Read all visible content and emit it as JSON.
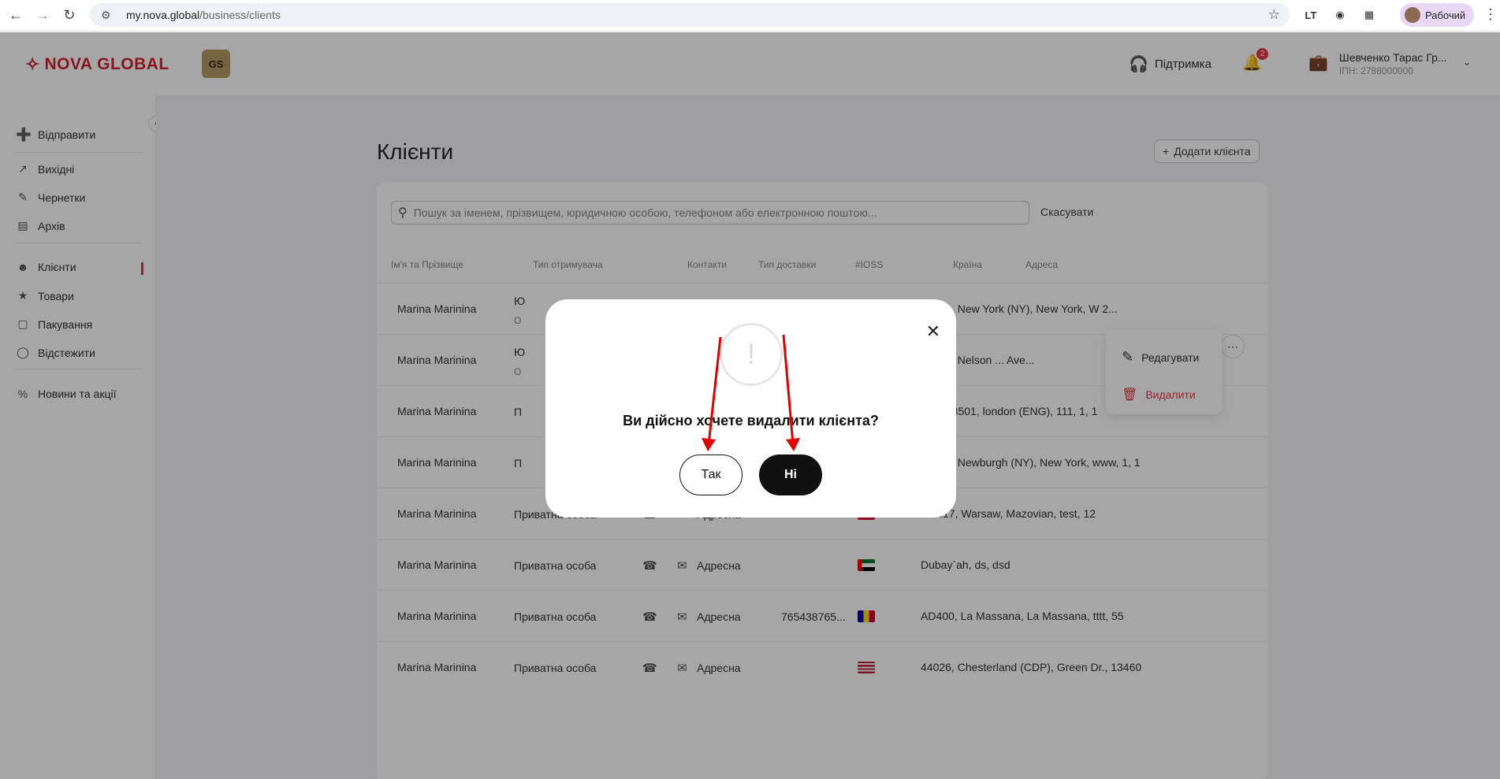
{
  "browser": {
    "url_host": "my.nova.global",
    "url_path": "/business/clients",
    "profile_label": "Рабочий"
  },
  "header": {
    "logo_text": "NOVA GLOBAL",
    "badge_text": "GS",
    "support_label": "Підтримка",
    "notifications_count": "2",
    "account_name": "Шевченко Тарас Гр...",
    "account_inn": "ІПН: 2788000000"
  },
  "sidebar": {
    "send_label": "Відправити",
    "items": [
      {
        "label": "Вихідні",
        "icon": "arrow-outgoing-icon"
      },
      {
        "label": "Чернетки",
        "icon": "edit-icon"
      },
      {
        "label": "Архів",
        "icon": "archive-icon"
      },
      {
        "label": "Клієнти",
        "icon": "user-icon"
      },
      {
        "label": "Товари",
        "icon": "tag-icon"
      },
      {
        "label": "Пакування",
        "icon": "box-icon"
      },
      {
        "label": "Відстежити",
        "icon": "track-icon"
      },
      {
        "label": "Новини та акції",
        "icon": "percent-icon"
      }
    ],
    "active_item": "Клієнти"
  },
  "main": {
    "title": "Клієнти",
    "add_button": "Додати клієнта",
    "search_placeholder": "Пошук за іменем, прізвищем, юридичною особою, телефоном або електронною поштою...",
    "cancel_label": "Скасувати",
    "columns": [
      "Ім'я та Прізвище",
      "Тип отримувача",
      "Контакти",
      "Тип доставки",
      "#IOSS",
      "Країна",
      "Адреса"
    ],
    "rows": [
      {
        "name": "Marina Marinina",
        "type": "Ю",
        "type_sub": "О",
        "delivery": "",
        "ioss": "",
        "flag": "us",
        "address": "10001, New York (NY), New York, W 2..."
      },
      {
        "name": "Marina Marinina",
        "type": "Ю",
        "type_sub": "О",
        "delivery": "",
        "ioss": "",
        "flag": "us",
        "address": "30151, Nelson ... Ave..."
      },
      {
        "name": "Marina Marinina",
        "type": "П",
        "type_sub": "",
        "delivery": "",
        "ioss": "",
        "flag": "gb",
        "address": "FTSE 3501, london (ENG), 111, 1, 1"
      },
      {
        "name": "Marina Marinina",
        "type": "П",
        "type_sub": "",
        "delivery": "",
        "ioss": "",
        "flag": "us",
        "address": "12551, Newburgh (NY), New York, www, 1, 1"
      },
      {
        "name": "Marina Marinina",
        "type": "Приватна особа",
        "type_sub": "",
        "delivery": "Адресна",
        "ioss": "",
        "flag": "pl",
        "address": "03-417, Warsaw, Mazovian, test, 12"
      },
      {
        "name": "Marina Marinina",
        "type": "Приватна особа",
        "type_sub": "",
        "delivery": "Адресна",
        "ioss": "",
        "flag": "ae",
        "address": "Dubay`ah, ds, dsd"
      },
      {
        "name": "Marina Marinina",
        "type": "Приватна особа",
        "type_sub": "",
        "delivery": "Адресна",
        "ioss": "765438765...",
        "flag": "ad",
        "address": "AD400, La Massana, La Massana, tttt, 55"
      },
      {
        "name": "Marina Marinina",
        "type": "Приватна особа",
        "type_sub": "",
        "delivery": "Адресна",
        "ioss": "",
        "flag": "us",
        "address": "44026, Chesterland (CDP), Green Dr., 13460"
      }
    ],
    "context_menu": {
      "edit_label": "Редагувати",
      "delete_label": "Видалити"
    }
  },
  "modal": {
    "question": "Ви дійсно хочете видалити клієнта?",
    "yes_label": "Так",
    "no_label": "Ні"
  },
  "colors": {
    "brand": "#d3232e",
    "annotation_arrow": "#e00000",
    "overlay": "rgba(0,0,0,0.35)"
  }
}
